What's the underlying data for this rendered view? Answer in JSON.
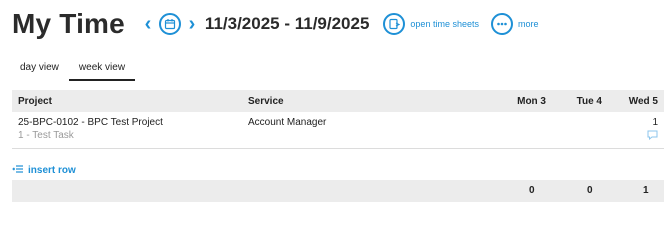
{
  "page": {
    "title": "My Time",
    "date_range": "11/3/2025 - 11/9/2025"
  },
  "toolbar": {
    "prev_icon": "chevron-left-icon",
    "calendar_icon": "calendar-icon",
    "next_icon": "chevron-right-icon",
    "open_time_sheets_label": "open time sheets",
    "more_label": "more"
  },
  "tabs": [
    {
      "label": "day view",
      "active": false
    },
    {
      "label": "week view",
      "active": true
    }
  ],
  "table": {
    "columns": {
      "project": "Project",
      "service": "Service",
      "mon": "Mon 3",
      "tue": "Tue 4",
      "wed": "Wed 5"
    },
    "rows": [
      {
        "project": "25-BPC-0102 - BPC Test Project",
        "task": "1 - Test Task",
        "service": "Account Manager",
        "mon": "",
        "tue": "",
        "wed": "1"
      }
    ]
  },
  "insert_row_label": "insert row",
  "totals": {
    "mon": "0",
    "tue": "0",
    "wed": "1"
  },
  "colors": {
    "accent": "#1e90d6",
    "header_bg": "#ececec"
  }
}
